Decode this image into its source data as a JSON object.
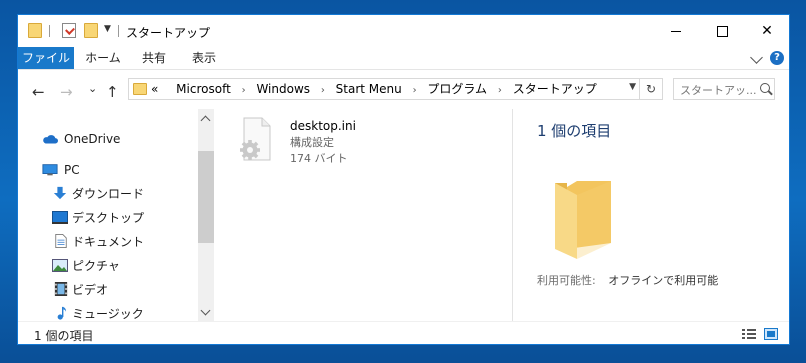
{
  "window": {
    "title": "スタートアップ",
    "close_glyph": "✕"
  },
  "ribbon": {
    "tabs": [
      "ファイル",
      "ホーム",
      "共有",
      "表示"
    ],
    "help_glyph": "?"
  },
  "nav": {
    "back_glyph": "←",
    "forward_glyph": "→",
    "recent_glyph": "⌄",
    "up_glyph": "↑"
  },
  "address": {
    "overflow_glyph": "«",
    "crumbs": [
      "Microsoft",
      "Windows",
      "Start Menu",
      "プログラム",
      "スタートアップ"
    ],
    "separator": "›",
    "refresh_glyph": "↻"
  },
  "search": {
    "placeholder": "スタートアッ..."
  },
  "sidebar": {
    "items": [
      {
        "label": "OneDrive",
        "icon": "onedrive-icon"
      },
      {
        "label": "PC",
        "icon": "pc-icon"
      },
      {
        "label": "ダウンロード",
        "icon": "download-icon"
      },
      {
        "label": "デスクトップ",
        "icon": "desktop-icon"
      },
      {
        "label": "ドキュメント",
        "icon": "documents-icon"
      },
      {
        "label": "ピクチャ",
        "icon": "pictures-icon"
      },
      {
        "label": "ビデオ",
        "icon": "videos-icon"
      },
      {
        "label": "ミュージック",
        "icon": "music-icon"
      }
    ]
  },
  "files": [
    {
      "name": "desktop.ini",
      "type": "構成設定",
      "size": "174 バイト",
      "icon": "settings-file-icon"
    }
  ],
  "details_pane": {
    "count": "1 個の項目",
    "availability_label": "利用可能性:",
    "availability_value": "オフラインで利用可能"
  },
  "status": {
    "text": "1 個の項目"
  },
  "colors": {
    "accent": "#1979ca",
    "folder": "#f8d675",
    "desktop_bg": "#0c63b1"
  }
}
